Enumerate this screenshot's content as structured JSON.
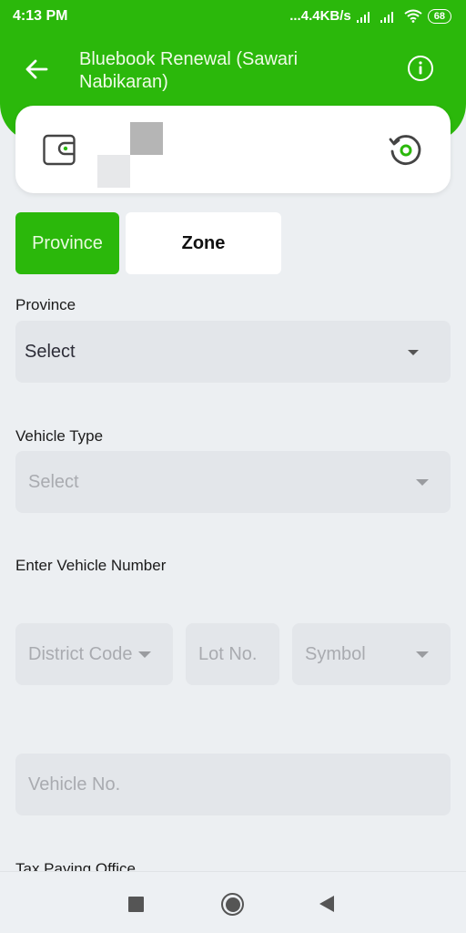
{
  "status_bar": {
    "time": "4:13 PM",
    "network_speed": "...4.4KB/s",
    "battery": "68",
    "icons": [
      "signal-icon",
      "signal-icon",
      "wifi-icon",
      "battery-icon"
    ]
  },
  "header": {
    "title": "Bluebook Renewal (Sawari Nabikaran)",
    "back_icon": "arrow-left-icon",
    "info_icon": "info-icon"
  },
  "wallet_card": {
    "wallet_icon": "wallet-icon",
    "balance": "",
    "refresh_icon": "refresh-icon"
  },
  "segment": {
    "options": [
      {
        "label": "Province",
        "selected": true
      },
      {
        "label": "Zone",
        "selected": false
      }
    ]
  },
  "form": {
    "province": {
      "label": "Province",
      "value": "Select"
    },
    "vehicle_type": {
      "label": "Vehicle Type",
      "placeholder": "Select"
    },
    "vehicle_number": {
      "label": "Enter Vehicle Number",
      "district_code": {
        "placeholder": "District Code"
      },
      "lot_no": {
        "placeholder": "Lot No."
      },
      "symbol": {
        "placeholder": "Symbol"
      },
      "vehicle_no": {
        "placeholder": "Vehicle No."
      }
    },
    "tax_paying_office": {
      "label": "Tax Paying Office"
    }
  },
  "colors": {
    "brand_green": "#2bb80b",
    "background": "#eceff2",
    "field_bg": "#e3e6ea"
  },
  "nav_bar": {
    "recents_icon": "square-icon",
    "home_icon": "circle-icon",
    "back_icon": "triangle-back-icon"
  }
}
